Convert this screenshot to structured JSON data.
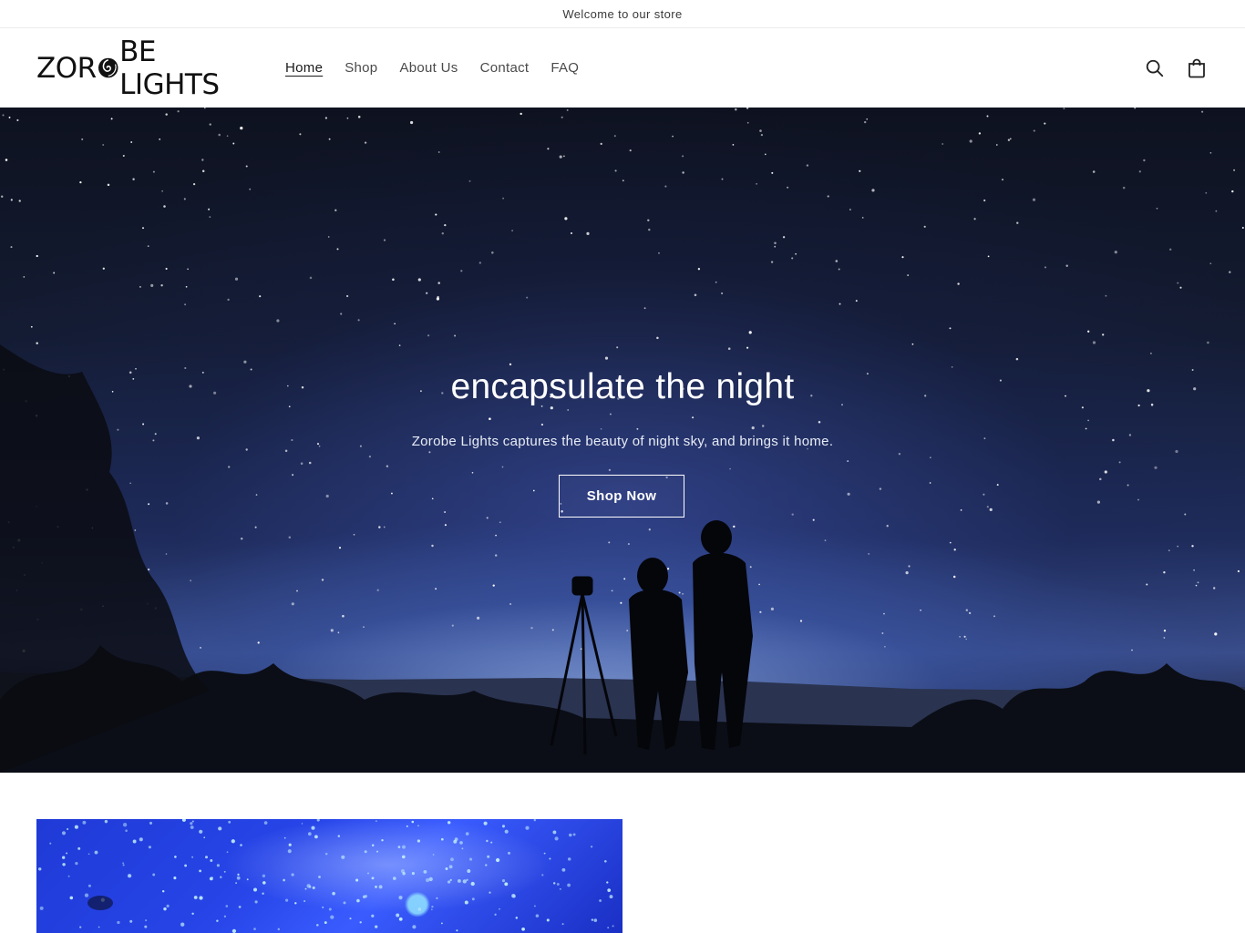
{
  "announcement": {
    "text": "Welcome to our store"
  },
  "header": {
    "logo": {
      "part1": "ZOR",
      "part2": "BE LIGHTS"
    },
    "nav": [
      {
        "label": "Home",
        "active": true
      },
      {
        "label": "Shop",
        "active": false
      },
      {
        "label": "About Us",
        "active": false
      },
      {
        "label": "Contact",
        "active": false
      },
      {
        "label": "FAQ",
        "active": false
      }
    ],
    "icons": [
      "search-icon",
      "cart-icon"
    ]
  },
  "hero": {
    "title": "encapsulate the night",
    "subtitle": "Zorobe Lights captures the beauty of night sky, and brings it home.",
    "button_label": "Shop Now"
  },
  "colors": {
    "text": "#1f1f1f",
    "hero_sky": "#1f2d5c",
    "feature_blue": "#2745e8"
  }
}
